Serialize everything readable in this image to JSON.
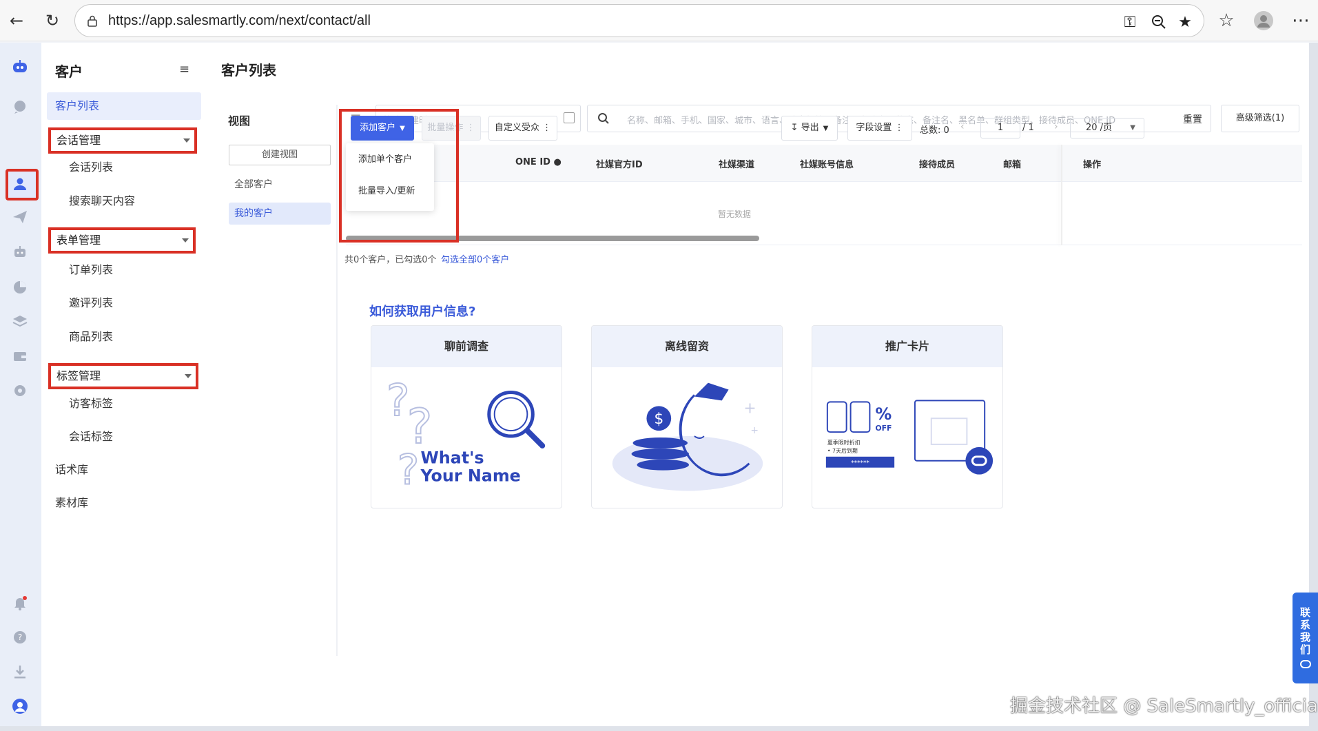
{
  "browser": {
    "url": "https://app.salesmartly.com/next/contact/all"
  },
  "sidebar": {
    "title": "客户",
    "items": [
      {
        "label": "客户列表"
      },
      {
        "label": "会话管理"
      },
      {
        "label": "会话列表"
      },
      {
        "label": "搜索聊天内容"
      },
      {
        "label": "表单管理"
      },
      {
        "label": "订单列表"
      },
      {
        "label": "邀评列表"
      },
      {
        "label": "商品列表"
      },
      {
        "label": "标签管理"
      },
      {
        "label": "访客标签"
      },
      {
        "label": "会话标签"
      },
      {
        "label": "话术库"
      },
      {
        "label": "素材库"
      }
    ]
  },
  "main": {
    "page_title": "客户列表",
    "views": {
      "title": "视图",
      "create_button": "创建视图",
      "items": [
        {
          "label": "全部客户"
        },
        {
          "label": "我的客户"
        }
      ]
    },
    "filters": {
      "date_placeholder": "筛选创建时间",
      "search_placeholder": "名称、邮箱、手机、国家、城市、语言、访客标签、备注、备注名、状态、备注名、黑名单、群组类型、接待成员、ONE ID",
      "reset": "重置",
      "advanced": "高级筛选(1)"
    },
    "toolbar": {
      "add_customer": "添加客户",
      "batch": "批量操作",
      "custom_audience": "自定义受众",
      "export": "导出",
      "fields": "字段设置",
      "total": "总数: 0",
      "page": "1",
      "pages": "/ 1",
      "per_page": "20 /页"
    },
    "add_menu": [
      "添加单个客户",
      "批量导入/更新"
    ],
    "table": {
      "headers": [
        "ONE ID",
        "社媒官方ID",
        "社媒渠道",
        "社媒账号信息",
        "接待成员",
        "邮箱",
        "操作"
      ],
      "empty": "暂无数据"
    },
    "summary": "共0个客户，已勾选0个",
    "select_all": "勾选全部0个客户",
    "howto_title": "如何获取用户信息?",
    "cards": [
      {
        "title": "聊前调查",
        "art_text_1": "What's",
        "art_text_2": "Your Name"
      },
      {
        "title": "离线留资"
      },
      {
        "title": "推广卡片",
        "art_percent": "%",
        "art_off": "OFF",
        "art_line_1": "夏季限时折扣",
        "art_line_2": "• 7天后到期",
        "art_stars": "******"
      }
    ]
  },
  "contact_tab": "联系我们",
  "watermark": "掘金技术社区 @ SaleSmartly_official",
  "colors": {
    "accent": "#3f63e6",
    "highlight_outline": "#d93025",
    "link": "#3b5bd9"
  }
}
